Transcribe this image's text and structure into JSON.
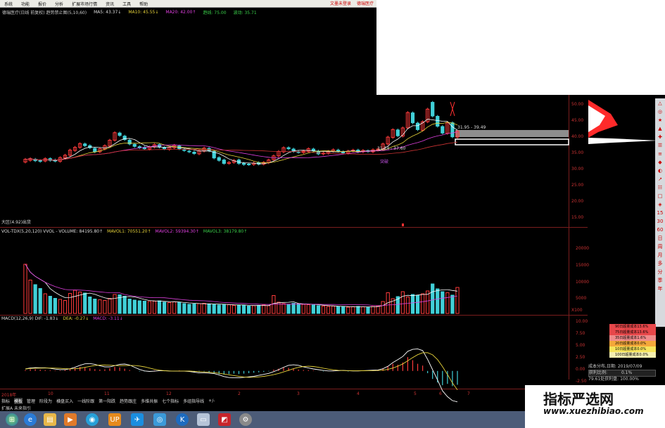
{
  "menu": {
    "items": [
      "系统",
      "功能",
      "报价",
      "分析",
      "扩展市场行情",
      "资讯",
      "工具",
      "帮助"
    ],
    "right_items": [
      "文墨未登录",
      "德瑞医疗"
    ]
  },
  "info_line": {
    "title": "德瑞医疗(日线 前复权) 趋势禁止图(5,10,60)",
    "ma5": "MA5: 43.37↓",
    "ma10": "MA10: 45.55↓",
    "ma20": "MA20: 42.00↑",
    "ma_dark": "趋线: 75.00",
    "ma_green": "波动: 35.71"
  },
  "price_labels": {
    "range_high": "31.95 - 39.49",
    "range_low": "31.24 - 37.60",
    "marker": "突破",
    "low_tag": "大区(4.92)出货"
  },
  "price_axis": [
    "50.00",
    "45.00",
    "40.00",
    "35.00",
    "30.00",
    "25.00",
    "20.00",
    "15.00"
  ],
  "vol_info": {
    "main": "VOL-TDX(5,20,120) VVOL -   VOLUME: 84195.80↑",
    "mavol1": "MAVOL1: 70551.20↑",
    "mavol2": "MAVOL2: 59394.30↑",
    "mavol3": "MAVOL3: 38179.80↑"
  },
  "vol_axis": [
    "20000",
    "15000",
    "10000",
    "5000",
    "X100"
  ],
  "macd_info": {
    "main": "MACD(12,26,9) DIF: -1.83↓",
    "dea": "DEA: -0.27↓",
    "macd": "MACD: -3.11↓"
  },
  "macd_axis": [
    "10.00",
    "7.50",
    "5.00",
    "2.50",
    "0.00",
    "-2.50"
  ],
  "date_axis": [
    "2018年",
    "10",
    "11",
    "12",
    "2",
    "3",
    "4",
    "5",
    "6",
    "7"
  ],
  "tabs": [
    "指标",
    "模板",
    "管理",
    "阶段为",
    "横盘买入",
    "一线阶跟",
    "第一阳跌",
    "趋势跟庄",
    "多维共振",
    "七个指标",
    "多组指导线",
    "+/-"
  ],
  "bottom_row": "扩展A  未来指引",
  "cost_rows": [
    {
      "label": "90日超量成本13.6%",
      "color": "#e8474a"
    },
    {
      "label": "75日超量成本13.6%",
      "color": "#e8474a"
    },
    {
      "label": "35日超量成本1.6%",
      "color": "#f08b8b"
    },
    {
      "label": "20日超量成本0.0%",
      "color": "#f4a83a"
    },
    {
      "label": "10日超量成本0.0%",
      "color": "#f6e45b"
    },
    {
      "label": "100日超量成本0.0%",
      "color": "#f6f0b0"
    }
  ],
  "cost_info": {
    "date": "成本分布,日期: 2019/07/09",
    "ratio_label": "获利比例:",
    "ratio_value": "0.1%",
    "avg": "79.61处获利盘: 100.00%"
  },
  "right_toolbar": [
    "△",
    "◎",
    "★",
    "▲",
    "✚",
    "☰",
    "≡",
    "◆",
    "◐",
    "↗",
    "☷",
    "□",
    "◈",
    "15",
    "30",
    "60",
    "日",
    "周",
    "月",
    "多",
    "分",
    "季",
    "年"
  ],
  "watermark": {
    "cn": "指标严选网",
    "url": "www.xuezhibiao.com"
  },
  "colors": {
    "up": "#ff3b3b",
    "down": "#41d0d8",
    "bg": "#000000",
    "grid": "#7a1d1d"
  },
  "chart_data": {
    "type": "candlestick",
    "price_ylim": [
      15,
      50
    ],
    "candles": [
      [
        33,
        33.8
      ],
      [
        33.5,
        34
      ],
      [
        33.8,
        33.4
      ],
      [
        33.4,
        33.2
      ],
      [
        33.3,
        34
      ],
      [
        34,
        33.5
      ],
      [
        33.6,
        33.3
      ],
      [
        33.2,
        34.3
      ],
      [
        34.2,
        35
      ],
      [
        35,
        36.5
      ],
      [
        36.4,
        37.3
      ],
      [
        37.3,
        38.4
      ],
      [
        38.3,
        37.8
      ],
      [
        37.8,
        37.2
      ],
      [
        37,
        36
      ],
      [
        36,
        36.9
      ],
      [
        36.8,
        37.8
      ],
      [
        37.7,
        39.4
      ],
      [
        39.4,
        41.6
      ],
      [
        41.5,
        40.8
      ],
      [
        40.6,
        39.6
      ],
      [
        39.4,
        38.3
      ],
      [
        38.2,
        37.6
      ],
      [
        37.5,
        37.2
      ],
      [
        37.3,
        36.9
      ],
      [
        36.8,
        37.4
      ],
      [
        37.4,
        38.1
      ],
      [
        38.1,
        37.4
      ],
      [
        37.2,
        36.9
      ],
      [
        36.7,
        37.3
      ],
      [
        37.2,
        37.9
      ],
      [
        37.7,
        36.9
      ],
      [
        36.6,
        36.4
      ],
      [
        36.2,
        36
      ],
      [
        35.9,
        35.5
      ],
      [
        35.4,
        36.3
      ],
      [
        36.2,
        37.1
      ],
      [
        37,
        36.3
      ],
      [
        36.1,
        34.2
      ],
      [
        34.3,
        33.5
      ],
      [
        33.6,
        32.6
      ],
      [
        32.6,
        32.9
      ],
      [
        32.9,
        33.5
      ],
      [
        33.6,
        32.6
      ],
      [
        32.6,
        32.3
      ],
      [
        32.4,
        32.3
      ],
      [
        32.3,
        32.7
      ],
      [
        32.8,
        32.4
      ],
      [
        32.4,
        32.9
      ],
      [
        32.8,
        33.6
      ],
      [
        33.7,
        34.8
      ],
      [
        34.8,
        36.1
      ],
      [
        36,
        37.2
      ],
      [
        37.2,
        36.9
      ],
      [
        36.8,
        36.1
      ],
      [
        36,
        35.9
      ],
      [
        35.8,
        36.2
      ],
      [
        36.2,
        36.9
      ],
      [
        36.8,
        36.3
      ],
      [
        36.2,
        35.4
      ],
      [
        35.4,
        35.6
      ],
      [
        35.6,
        36.1
      ],
      [
        36.2,
        36.6
      ],
      [
        36.5,
        36.2
      ],
      [
        36,
        35.7
      ],
      [
        35.6,
        36.2
      ],
      [
        36.3,
        36.5
      ],
      [
        36.5,
        36
      ],
      [
        36,
        36.4
      ],
      [
        36.3,
        36.1
      ],
      [
        36,
        36.6
      ],
      [
        36.5,
        36.8
      ],
      [
        36.8,
        38.3
      ],
      [
        38.3,
        40.3
      ],
      [
        40.2,
        42.5
      ],
      [
        42.4,
        40.7
      ],
      [
        40.6,
        43
      ],
      [
        43,
        47.5
      ],
      [
        47.4,
        44.5
      ],
      [
        44.4,
        42.5
      ],
      [
        42.3,
        44.8
      ],
      [
        44.8,
        48.5
      ],
      [
        50.5,
        46.5
      ],
      [
        46.4,
        43.5
      ],
      [
        43.4,
        41.5
      ],
      [
        41.4,
        44.5
      ],
      [
        44.5,
        40.4
      ],
      [
        40.3,
        42
      ]
    ],
    "volume": [
      14000,
      9500,
      8200,
      7100,
      5600,
      4900,
      4300,
      4000,
      3700,
      5700,
      6600,
      6100,
      5800,
      4700,
      4100,
      3900,
      3700,
      4300,
      5400,
      5300,
      4900,
      4100,
      3800,
      3600,
      3500,
      3400,
      3500,
      3600,
      3200,
      3100,
      3300,
      3200,
      2800,
      2600,
      2700,
      2800,
      2900,
      2700,
      2500,
      2400,
      2600,
      2500,
      2300,
      2400,
      2300,
      2100,
      2200,
      2300,
      2400,
      2200,
      5100,
      3200,
      2800,
      2600,
      2900,
      2700,
      2600,
      2500,
      2400,
      2200,
      2100,
      2000,
      2100,
      1900,
      2000,
      1800,
      1900,
      2000,
      1900,
      1800,
      2000,
      2100,
      3400,
      5900,
      4200,
      4800,
      6200,
      4700,
      5400,
      5100,
      5600,
      6400,
      8400,
      7000,
      6200,
      5900,
      5200,
      7400
    ],
    "macd_hist": [
      0.2,
      0.4,
      0.4,
      0.3,
      0.2,
      0.15,
      0.1,
      0.1,
      0.2,
      0.5,
      0.7,
      0.9,
      0.8,
      0.6,
      0.4,
      0.3,
      0.35,
      0.6,
      0.9,
      0.8,
      0.5,
      0.2,
      0.0,
      -0.1,
      -0.1,
      0,
      0.1,
      0.05,
      -0.05,
      -0.1,
      0,
      0.1,
      -0.1,
      -0.2,
      -0.3,
      -0.2,
      -0.1,
      -0.3,
      -0.5,
      -0.7,
      -0.8,
      -0.7,
      -0.6,
      -0.7,
      -0.6,
      -0.5,
      -0.4,
      -0.3,
      -0.2,
      -0.1,
      0.3,
      0.5,
      0.8,
      0.7,
      0.5,
      0.3,
      0.2,
      0.2,
      0.1,
      0,
      -0.1,
      0,
      0.1,
      0.1,
      0,
      -0.1,
      0,
      0.1,
      0.1,
      0,
      0.1,
      0.2,
      0.6,
      1.0,
      1.6,
      1.4,
      1.9,
      3.1,
      2.4,
      1.6,
      1.2,
      -0.5,
      -1.8,
      -2.6,
      -3.2,
      -2.9,
      -3.4,
      -3.1
    ],
    "macd_ylim": [
      -3.5,
      11
    ]
  }
}
